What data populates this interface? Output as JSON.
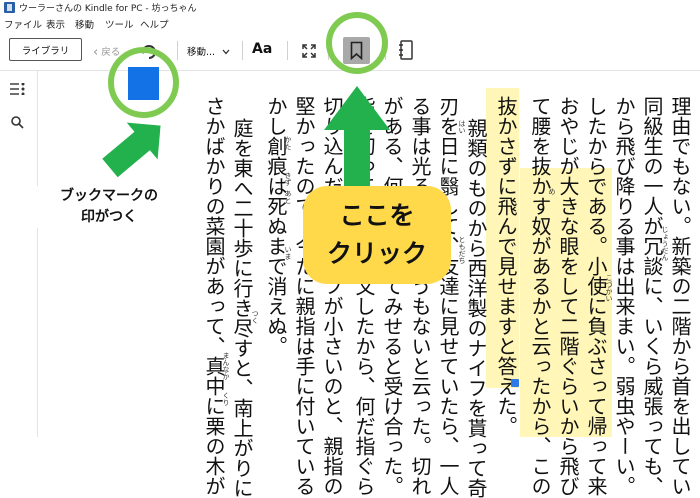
{
  "window": {
    "title": "ウーラーさんの Kindle for PC - 坊っちゃん"
  },
  "menubar": {
    "items": [
      "ファイル",
      "表示",
      "移動",
      "ツール",
      "ヘルプ"
    ]
  },
  "toolbar": {
    "library_label": "ライブラリ",
    "back_label": "戻る",
    "move_label": "移動...",
    "font_label": "Aa"
  },
  "page": {
    "columns": [
      "理由でもない。新築の二階から首を出してい",
      "同級生の一人が冗談に、いくら威張っても、",
      "から飛び降りる事は出来まい。弱虫やーい。",
      "したからである。小使に負ぶさって帰って来",
      "おやじが大きな眼をして二階ぐらいから飛び",
      "て腰を抜かす奴があるかと云ったから、この",
      "抜かさずに飛んで見せますと答えた。",
      "親類のものから西洋製のナイフを貰って奇",
      "刃を日に翳して、友達に見せていたら、一人",
      "る事は光るが切れそうもないと云った。切れ",
      "がある、何でも切ってみせると受け合った。",
      "指を切ってみろと注文したから、何だ指ぐら",
      "切り込んだ。幸ナイフが小さいのと、親指の",
      "堅かったので、今だに親指は手に付いている",
      "かし創痕は死ぬまで消えぬ。",
      "庭を東へ二十歩に行き尽すと、南上がりに",
      "さかばかりの菜園があって、真中に栗の木が"
    ],
    "ruby": [
      "じょうだん",
      "こづかい",
      "め",
      "はい",
      "ともだち",
      "きず",
      "あと",
      "かた",
      "いま",
      "つく",
      "まんなか",
      "くり"
    ]
  },
  "annotations": {
    "bookmark_note": [
      "ブックマークの",
      "印がつく"
    ],
    "click_note": [
      "ここを",
      "クリック"
    ]
  },
  "colors": {
    "highlight": "#fff6b8",
    "bookmark_marker": "#1372e6",
    "annotation_ring": "#7fcb52",
    "annotation_arrow": "#22b14c",
    "callout_bubble": "#ffd94a"
  }
}
